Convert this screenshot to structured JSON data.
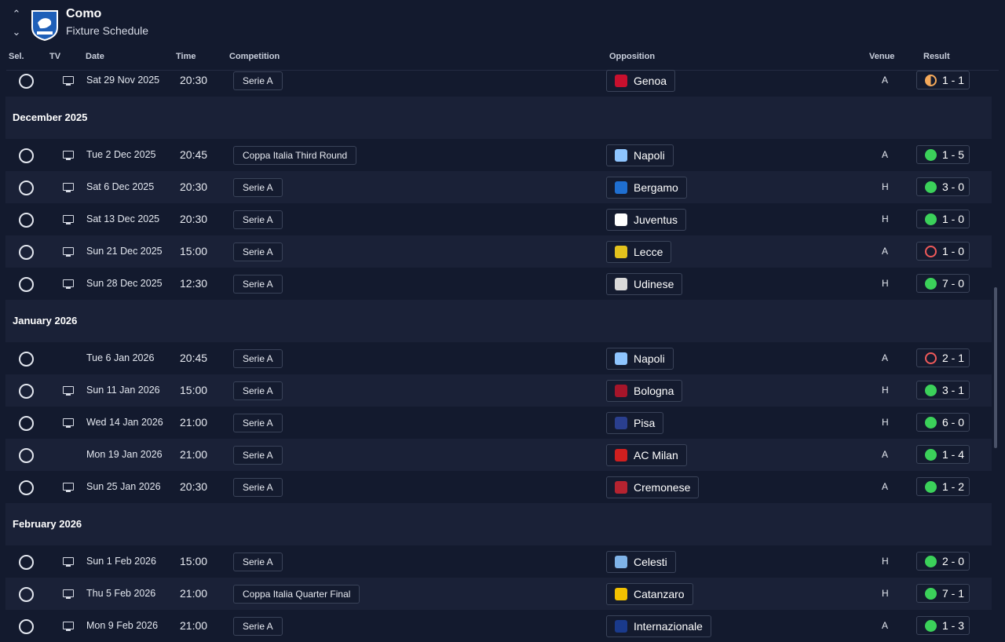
{
  "header": {
    "club": "Como",
    "subtitle": "Fixture Schedule"
  },
  "columns": {
    "sel": "Sel.",
    "tv": "TV",
    "date": "Date",
    "time": "Time",
    "competition": "Competition",
    "opposition": "Opposition",
    "venue": "Venue",
    "result": "Result"
  },
  "colors": {
    "win": "#3bd15a",
    "loss": "#f05a5a",
    "draw": "#f4a95a",
    "background": "#131a2e"
  },
  "top_fixture": {
    "date": "Sat 29 Nov 2025",
    "time": "20:30",
    "competition": "Serie A",
    "opponent": "Genoa",
    "venue": "A",
    "score": "1 - 1",
    "outcome": "D",
    "tv": true
  },
  "months": [
    {
      "label": "December 2025",
      "fixtures": [
        {
          "date": "Tue 2 Dec 2025",
          "time": "20:45",
          "competition": "Coppa Italia Third Round",
          "opponent": "Napoli",
          "venue": "A",
          "score": "1 - 5",
          "outcome": "W",
          "tv": true
        },
        {
          "date": "Sat 6 Dec 2025",
          "time": "20:30",
          "competition": "Serie A",
          "opponent": "Bergamo",
          "venue": "H",
          "score": "3 - 0",
          "outcome": "W",
          "tv": true
        },
        {
          "date": "Sat 13 Dec 2025",
          "time": "20:30",
          "competition": "Serie A",
          "opponent": "Juventus",
          "venue": "H",
          "score": "1 - 0",
          "outcome": "W",
          "tv": true
        },
        {
          "date": "Sun 21 Dec 2025",
          "time": "15:00",
          "competition": "Serie A",
          "opponent": "Lecce",
          "venue": "A",
          "score": "1 - 0",
          "outcome": "L",
          "tv": true
        },
        {
          "date": "Sun 28 Dec 2025",
          "time": "12:30",
          "competition": "Serie A",
          "opponent": "Udinese",
          "venue": "H",
          "score": "7 - 0",
          "outcome": "W",
          "tv": true
        }
      ]
    },
    {
      "label": "January 2026",
      "fixtures": [
        {
          "date": "Tue 6 Jan 2026",
          "time": "20:45",
          "competition": "Serie A",
          "opponent": "Napoli",
          "venue": "A",
          "score": "2 - 1",
          "outcome": "L",
          "tv": false
        },
        {
          "date": "Sun 11 Jan 2026",
          "time": "15:00",
          "competition": "Serie A",
          "opponent": "Bologna",
          "venue": "H",
          "score": "3 - 1",
          "outcome": "W",
          "tv": true
        },
        {
          "date": "Wed 14 Jan 2026",
          "time": "21:00",
          "competition": "Serie A",
          "opponent": "Pisa",
          "venue": "H",
          "score": "6 - 0",
          "outcome": "W",
          "tv": true
        },
        {
          "date": "Mon 19 Jan 2026",
          "time": "21:00",
          "competition": "Serie A",
          "opponent": "AC Milan",
          "venue": "A",
          "score": "1 - 4",
          "outcome": "W",
          "tv": false
        },
        {
          "date": "Sun 25 Jan 2026",
          "time": "20:30",
          "competition": "Serie A",
          "opponent": "Cremonese",
          "venue": "A",
          "score": "1 - 2",
          "outcome": "W",
          "tv": true
        }
      ]
    },
    {
      "label": "February 2026",
      "fixtures": [
        {
          "date": "Sun 1 Feb 2026",
          "time": "15:00",
          "competition": "Serie A",
          "opponent": "Celesti",
          "venue": "H",
          "score": "2 - 0",
          "outcome": "W",
          "tv": true
        },
        {
          "date": "Thu 5 Feb 2026",
          "time": "21:00",
          "competition": "Coppa Italia Quarter Final",
          "opponent": "Catanzaro",
          "venue": "H",
          "score": "7 - 1",
          "outcome": "W",
          "tv": true
        },
        {
          "date": "Mon 9 Feb 2026",
          "time": "21:00",
          "competition": "Serie A",
          "opponent": "Internazionale",
          "venue": "A",
          "score": "1 - 3",
          "outcome": "W",
          "tv": true
        }
      ]
    }
  ]
}
